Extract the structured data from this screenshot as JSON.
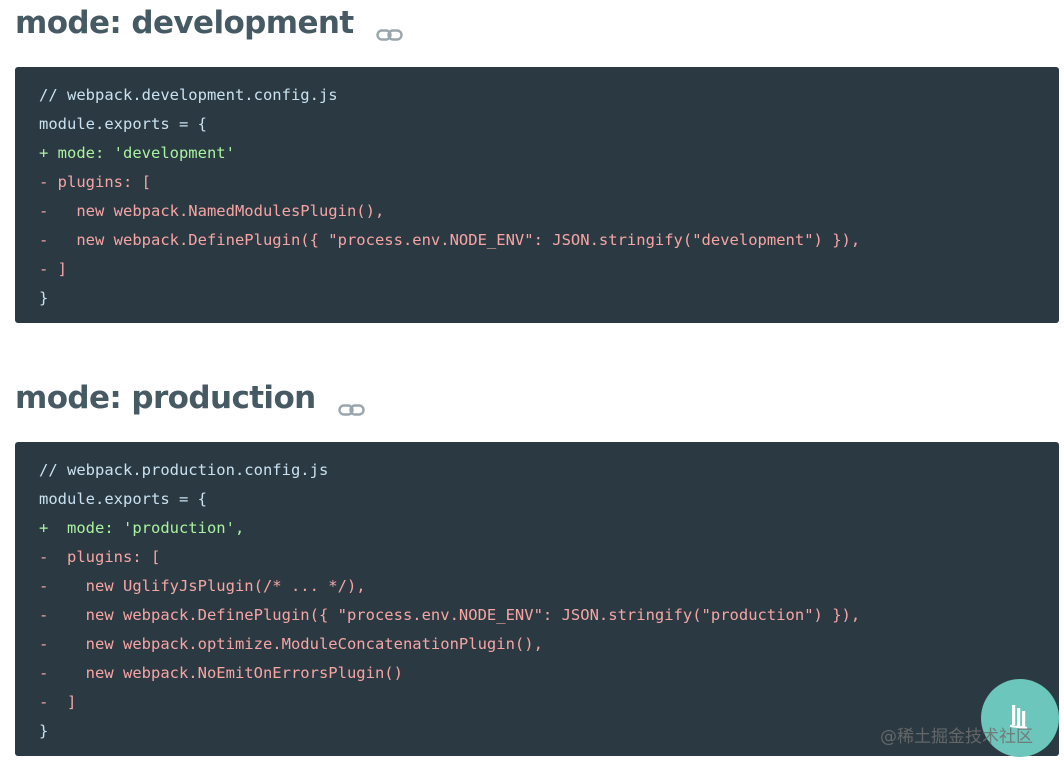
{
  "sections": [
    {
      "title": "mode: development",
      "code": [
        {
          "kind": "comment",
          "text": "// webpack.development.config.js"
        },
        {
          "kind": "normal",
          "text": "module.exports = {"
        },
        {
          "kind": "add",
          "text": "+ mode: 'development'"
        },
        {
          "kind": "del",
          "text": "- plugins: ["
        },
        {
          "kind": "del",
          "text": "-   new webpack.NamedModulesPlugin(),"
        },
        {
          "kind": "del",
          "text": "-   new webpack.DefinePlugin({ \"process.env.NODE_ENV\": JSON.stringify(\"development\") }),"
        },
        {
          "kind": "del",
          "text": "- ]"
        },
        {
          "kind": "normal",
          "text": "}"
        }
      ]
    },
    {
      "title": "mode: production",
      "code": [
        {
          "kind": "comment",
          "text": "// webpack.production.config.js"
        },
        {
          "kind": "normal",
          "text": "module.exports = {"
        },
        {
          "kind": "add",
          "text": "+  mode: 'production',"
        },
        {
          "kind": "del",
          "text": "-  plugins: ["
        },
        {
          "kind": "del",
          "text": "-    new UglifyJsPlugin(/* ... */),"
        },
        {
          "kind": "del",
          "text": "-    new webpack.DefinePlugin({ \"process.env.NODE_ENV\": JSON.stringify(\"production\") }),"
        },
        {
          "kind": "del",
          "text": "-    new webpack.optimize.ModuleConcatenationPlugin(),"
        },
        {
          "kind": "del",
          "text": "-    new webpack.NoEmitOnErrorsPlugin()"
        },
        {
          "kind": "del",
          "text": "-  ]"
        },
        {
          "kind": "normal",
          "text": "}"
        }
      ]
    }
  ],
  "colors": {
    "heading": "#465a64",
    "code_bg": "#2b3a42",
    "added": "#a9f2a0",
    "removed": "#f6a5a5",
    "plain": "#c9e1f0",
    "fab": "#6cc6bb"
  },
  "icons": {
    "heading_anchor": "link-icon",
    "fab": "juejin-logo-icon"
  },
  "watermark": "@稀土掘金技术社区"
}
